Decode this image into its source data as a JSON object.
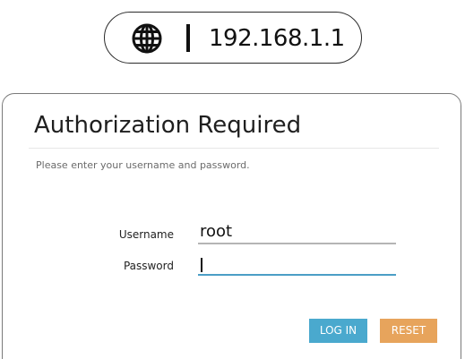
{
  "address_bar": {
    "icon": "globe-icon",
    "url": "192.168.1.1"
  },
  "login": {
    "title": "Authorization Required",
    "subtitle": "Please enter your username and password.",
    "username_label": "Username",
    "username_value": "root",
    "password_label": "Password",
    "password_value": "",
    "login_button": "LOG IN",
    "reset_button": "RESET"
  },
  "colors": {
    "login_button": "#4aa9ce",
    "reset_button": "#e7a45c",
    "focus_underline": "#4b9ec6",
    "idle_underline": "#b5b5b5"
  }
}
